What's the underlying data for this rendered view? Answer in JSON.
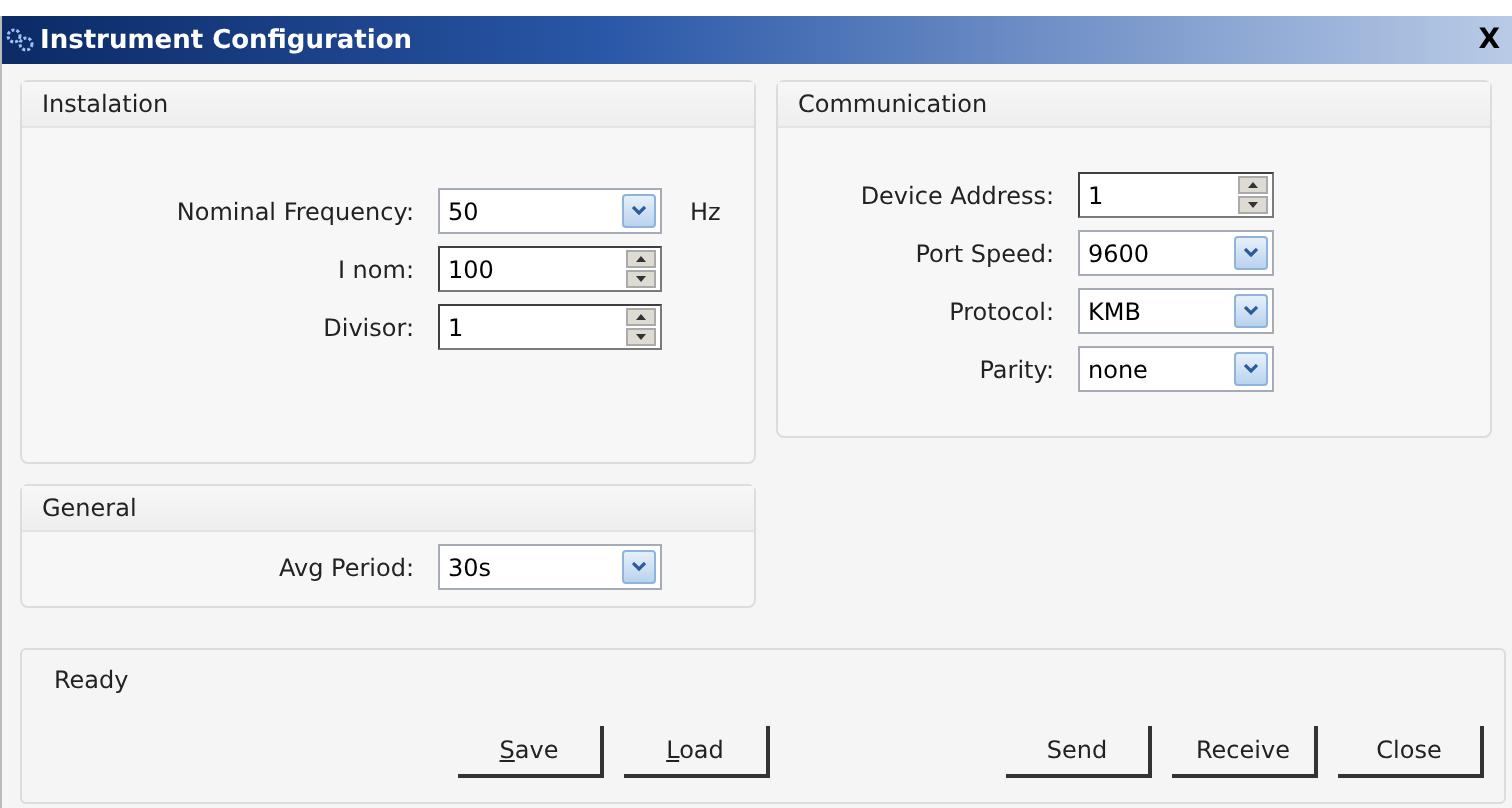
{
  "window": {
    "title": "Instrument Configuration",
    "close": "X"
  },
  "panels": [
    {
      "title": "Instalation",
      "fields": [
        {
          "label": "Nominal Frequency:",
          "kind": "combo",
          "value": "50",
          "unit": "Hz"
        },
        {
          "label": "I nom:",
          "kind": "spin",
          "value": "100"
        },
        {
          "label": "Divisor:",
          "kind": "spin",
          "value": "1"
        }
      ]
    },
    {
      "title": "Communication",
      "fields": [
        {
          "label": "Device Address:",
          "kind": "spin",
          "value": "1"
        },
        {
          "label": "Port Speed:",
          "kind": "combo",
          "value": "9600"
        },
        {
          "label": "Protocol:",
          "kind": "combo",
          "value": "KMB"
        },
        {
          "label": "Parity:",
          "kind": "combo",
          "value": "none"
        }
      ]
    },
    {
      "title": "General",
      "fields": [
        {
          "label": "Avg Period:",
          "kind": "combo",
          "value": "30s"
        }
      ]
    }
  ],
  "status": "Ready",
  "buttons": [
    {
      "label": "Save",
      "mnemonic": true
    },
    {
      "label": "Load",
      "mnemonic": true
    },
    {
      "label": "Send",
      "mnemonic": false
    },
    {
      "label": "Receive",
      "mnemonic": false
    },
    {
      "label": "Close",
      "mnemonic": false
    }
  ]
}
